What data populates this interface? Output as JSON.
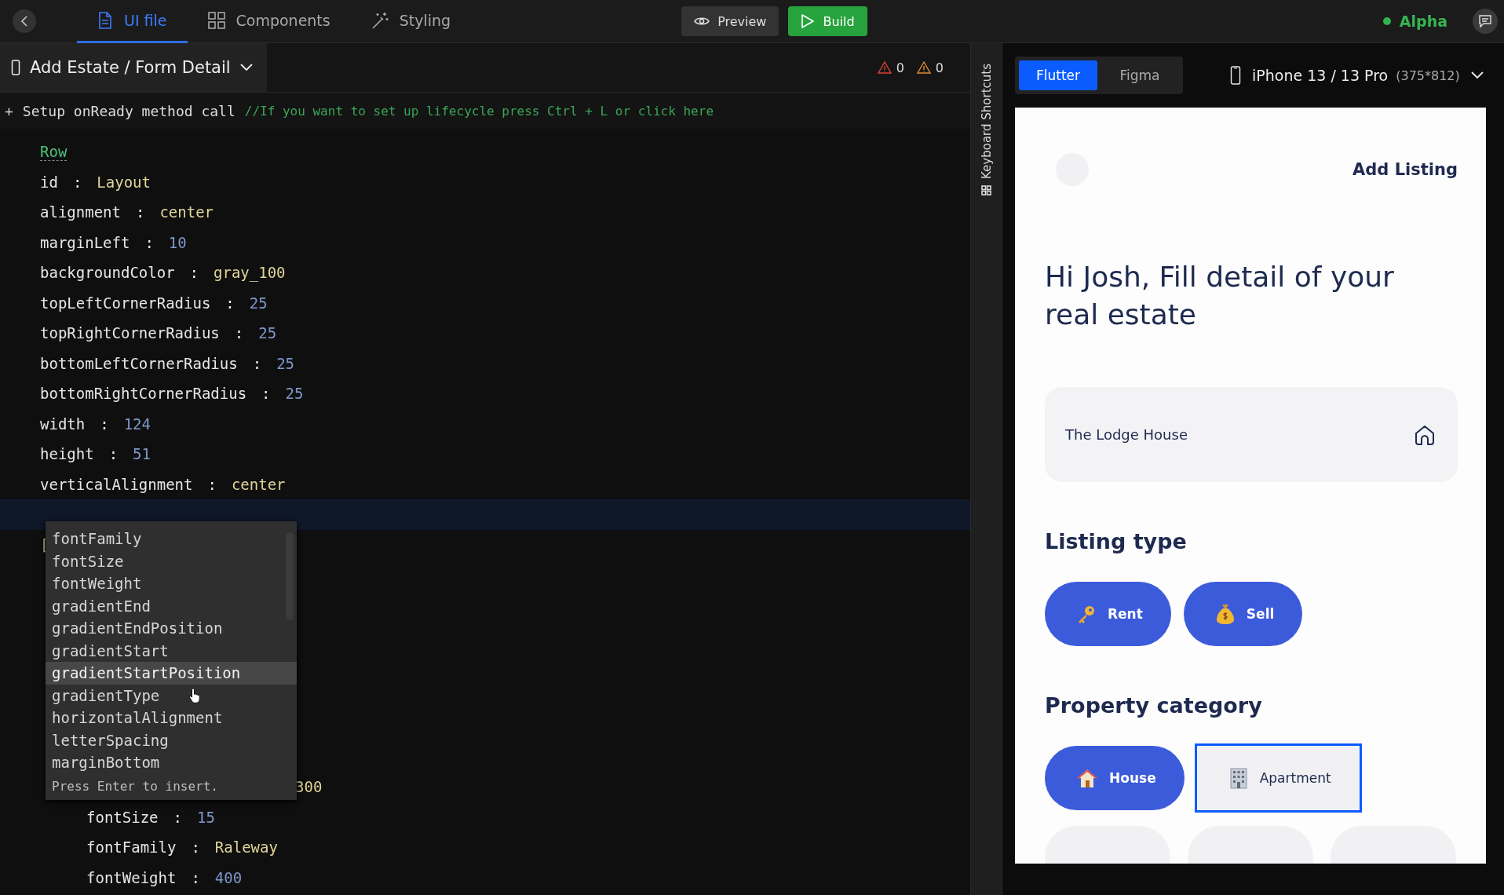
{
  "top_bar": {
    "tabs": [
      {
        "label": "UI file",
        "selected": true
      },
      {
        "label": "Components",
        "selected": false
      },
      {
        "label": "Styling",
        "selected": false
      }
    ],
    "preview_button": "Preview",
    "build_button": "Build",
    "channel": "Alpha"
  },
  "editor": {
    "file_tab": "Add Estate / Form Detail",
    "errors": "0",
    "warnings": "0",
    "setup_line": {
      "plus": "+",
      "text": "Setup onReady method call",
      "comment": "//If you want to set up lifecycle press Ctrl + L or click here"
    },
    "lines": [
      {
        "kind": "header",
        "text": "Row"
      },
      {
        "kind": "prop_text",
        "key": "id",
        "separator": ":",
        "value": "Layout"
      },
      {
        "kind": "prop_text",
        "key": "alignment",
        "separator": ":",
        "value": "center"
      },
      {
        "kind": "prop_number",
        "key": "marginLeft",
        "separator": ":",
        "value": "10"
      },
      {
        "kind": "prop_text",
        "key": "backgroundColor",
        "separator": ":",
        "value": "gray_100"
      },
      {
        "kind": "prop_number",
        "key": "topLeftCornerRadius",
        "separator": ":",
        "value": "25"
      },
      {
        "kind": "prop_number",
        "key": "topRightCornerRadius",
        "separator": ":",
        "value": "25"
      },
      {
        "kind": "prop_number",
        "key": "bottomLeftCornerRadius",
        "separator": ":",
        "value": "25"
      },
      {
        "kind": "prop_number",
        "key": "bottomRightCornerRadius",
        "separator": ":",
        "value": "25"
      },
      {
        "kind": "prop_number",
        "key": "width",
        "separator": ":",
        "value": "124"
      },
      {
        "kind": "prop_number",
        "key": "height",
        "separator": ":",
        "value": "51"
      },
      {
        "kind": "prop_text",
        "key": "verticalAlignment",
        "separator": ":",
        "value": "center"
      },
      {
        "kind": "blank",
        "current": true
      },
      {
        "kind": "bracket",
        "text": "["
      },
      {
        "kind": "value_text",
        "value": "300"
      },
      {
        "kind": "nested_number",
        "key": "fontSize",
        "separator": ":",
        "value": "15"
      },
      {
        "kind": "nested_text",
        "key": "fontFamily",
        "separator": ":",
        "value": "Raleway"
      },
      {
        "kind": "nested_number",
        "key": "fontWeight",
        "separator": ":",
        "value": "400"
      }
    ],
    "autocomplete": {
      "items": [
        {
          "label": "fontFamily",
          "selected": false
        },
        {
          "label": "fontSize",
          "selected": false
        },
        {
          "label": "fontWeight",
          "selected": false
        },
        {
          "label": "gradientEnd",
          "selected": false
        },
        {
          "label": "gradientEndPosition",
          "selected": false
        },
        {
          "label": "gradientStart",
          "selected": false
        },
        {
          "label": "gradientStartPosition",
          "selected": true
        },
        {
          "label": "gradientType",
          "selected": false
        },
        {
          "label": "horizontalAlignment",
          "selected": false
        },
        {
          "label": "letterSpacing",
          "selected": false
        },
        {
          "label": "marginBottom",
          "selected": false
        }
      ],
      "hint": "Press Enter to insert."
    }
  },
  "side_strip": {
    "label": "Keyboard Shortcuts"
  },
  "preview": {
    "modes": [
      {
        "label": "Flutter",
        "selected": true
      },
      {
        "label": "Figma",
        "selected": false
      }
    ],
    "device": "iPhone 13 / 13 Pro",
    "device_size": "(375*812)",
    "screen": {
      "title": "Add Listing",
      "greeting": "Hi Josh, Fill detail of your real estate",
      "name_field": "The Lodge House",
      "sections": [
        {
          "heading": "Listing type",
          "chips": [
            {
              "label": "Rent",
              "filled": true,
              "highlighted": false
            },
            {
              "label": "Sell",
              "filled": true,
              "highlighted": false
            }
          ]
        },
        {
          "heading": "Property category",
          "chips": [
            {
              "label": "House",
              "filled": true,
              "highlighted": false
            },
            {
              "label": "Apartment",
              "filled": false,
              "highlighted": true
            }
          ]
        }
      ]
    }
  }
}
